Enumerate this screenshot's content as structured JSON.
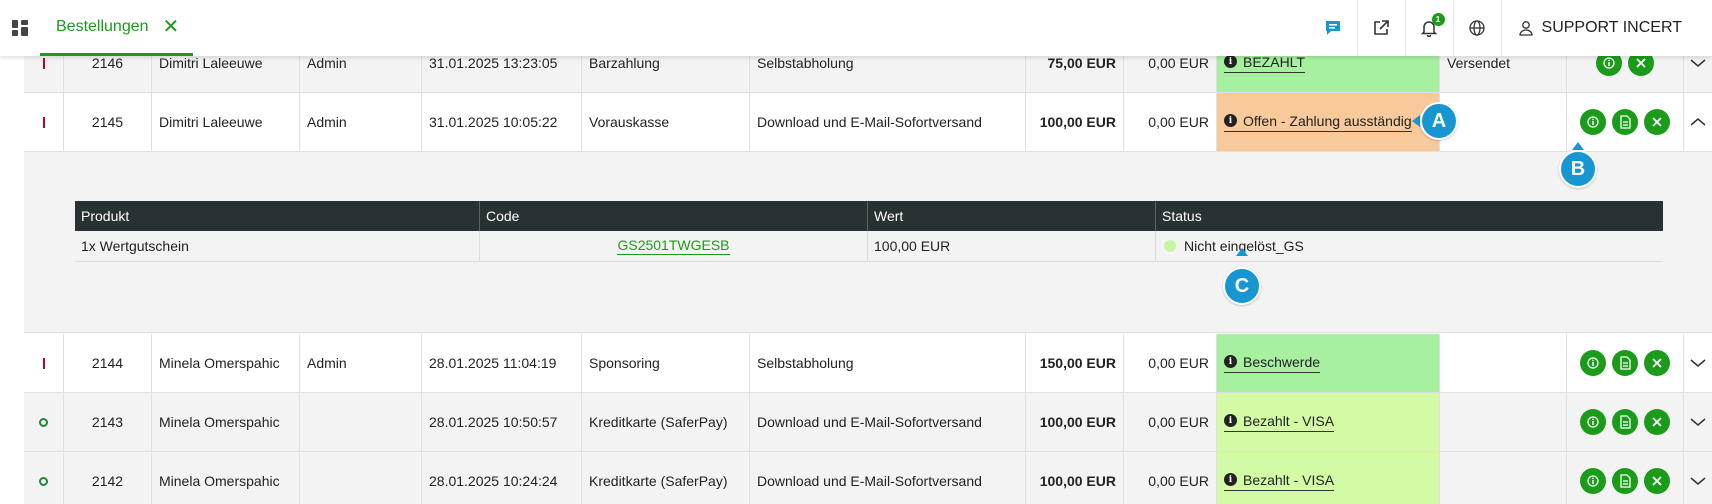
{
  "tab": {
    "label": "Bestellungen"
  },
  "user": {
    "name": "SUPPORT INCERT"
  },
  "notifications": {
    "count": "1"
  },
  "orders": [
    {
      "id": "2146",
      "customer": "Dimitri Laleeuwe",
      "role": "Admin",
      "date": "31.01.2025 13:23:05",
      "payment": "Barzahlung",
      "shipping": "Selbstabholung",
      "amount": "75,00 EUR",
      "fee": "0,00 EUR",
      "status": "BEZAHLT",
      "extra": "Versendet"
    },
    {
      "id": "2145",
      "customer": "Dimitri Laleeuwe",
      "role": "Admin",
      "date": "31.01.2025 10:05:22",
      "payment": "Vorauskasse",
      "shipping": "Download und E-Mail-Sofortversand",
      "amount": "100,00 EUR",
      "fee": "0,00 EUR",
      "status": "Offen - Zahlung ausständig",
      "extra": ""
    },
    {
      "id": "2144",
      "customer": "Minela Omerspahic",
      "role": "Admin",
      "date": "28.01.2025 11:04:19",
      "payment": "Sponsoring",
      "shipping": "Selbstabholung",
      "amount": "150,00 EUR",
      "fee": "0,00 EUR",
      "status": "Beschwerde",
      "extra": ""
    },
    {
      "id": "2143",
      "customer": "Minela Omerspahic",
      "role": "",
      "date": "28.01.2025 10:50:57",
      "payment": "Kreditkarte (SaferPay)",
      "shipping": "Download und E-Mail-Sofortversand",
      "amount": "100,00 EUR",
      "fee": "0,00 EUR",
      "status": "Bezahlt - VISA",
      "extra": ""
    },
    {
      "id": "2142",
      "customer": "Minela Omerspahic",
      "role": "",
      "date": "28.01.2025 10:24:24",
      "payment": "Kreditkarte (SaferPay)",
      "shipping": "Download und E-Mail-Sofortversand",
      "amount": "100,00 EUR",
      "fee": "0,00 EUR",
      "status": "Bezahlt - VISA",
      "extra": ""
    }
  ],
  "details": {
    "headers": {
      "product": "Produkt",
      "code": "Code",
      "value": "Wert",
      "status": "Status"
    },
    "row": {
      "product": "1x Wertgutschein",
      "code": "GS2501TWGESB",
      "value": "100,00 EUR",
      "status": "Nicht eingelöst_GS"
    }
  },
  "callouts": {
    "a": "A",
    "b": "B",
    "c": "C"
  },
  "colors": {
    "accent": "#1a9c1a",
    "status_paid": "#a6f0a0",
    "status_open": "#f8c99a",
    "status_visa": "#d3fba5",
    "callout": "#1796d2",
    "dark_header": "#283134"
  }
}
